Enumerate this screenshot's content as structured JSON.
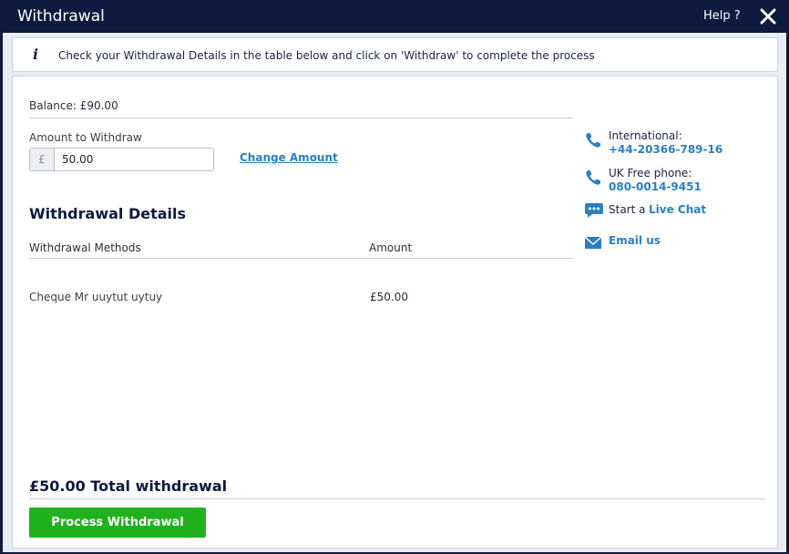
{
  "window": {
    "title": "Withdrawal",
    "help_label": "Help ?",
    "close_icon": "close-icon"
  },
  "info": {
    "icon": "info-icon",
    "text": "Check your Withdrawal Details in the table below and click on 'Withdraw' to complete the process"
  },
  "form": {
    "balance": "Balance: £90.00",
    "amount_label": "Amount to Withdraw",
    "currency": "£",
    "amount_value": "50.00",
    "change_amount": "Change Amount"
  },
  "details": {
    "title": "Withdrawal Details",
    "columns": [
      "Withdrawal Methods",
      "Amount"
    ],
    "rows": [
      {
        "method": "Cheque Mr uuytut uytuy",
        "amount": "£50.00"
      }
    ]
  },
  "contact": {
    "international_label": "International:",
    "international_number": "+44-20366-789-16",
    "uk_label": "UK Free phone:",
    "uk_number": "080-0014-9451",
    "chat_prefix": "Start a",
    "chat_link": "Live Chat",
    "email_link": "Email us",
    "icons": [
      "phone-icon",
      "phone-icon",
      "chat-icon",
      "email-icon"
    ],
    "accent_color": "#2a7fc2"
  },
  "footer": {
    "total": "£50.00 Total withdrawal",
    "process_button": "Process Withdrawal",
    "button_color": "#20b21e"
  },
  "colors": {
    "header_bg": "#0e1a3e",
    "panel_bg": "#e9eef5"
  }
}
